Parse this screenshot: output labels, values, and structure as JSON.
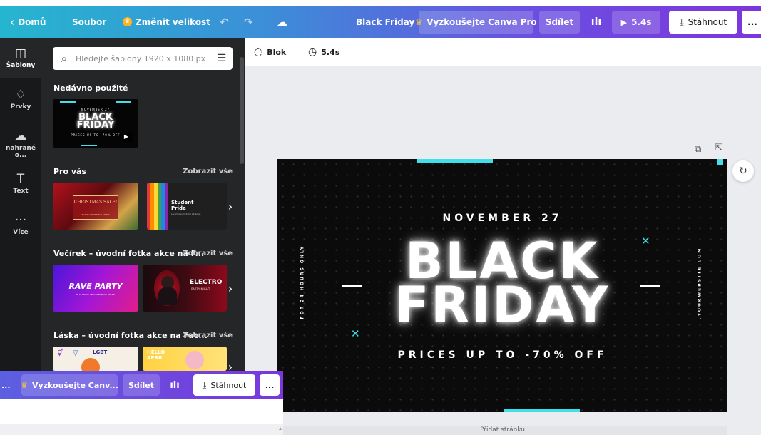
{
  "topbar": {
    "home_label": "Domů",
    "file_label": "Soubor",
    "resize_label": "Změnit velikost",
    "doc_title": "Black Friday",
    "pro_label": "Vyzkoušejte Canva Pro",
    "share_label": "Sdílet",
    "play_label": "5.4s",
    "download_label": "Stáhnout",
    "more_label": "..."
  },
  "rail": {
    "items": [
      {
        "label": "Šablony",
        "icon": "template-icon"
      },
      {
        "label": "Prvky",
        "icon": "elements-icon"
      },
      {
        "label": "nahrané o...",
        "icon": "upload-icon"
      },
      {
        "label": "Text",
        "icon": "text-icon"
      },
      {
        "label": "Více",
        "icon": "more-icon"
      }
    ]
  },
  "panel": {
    "search_placeholder": "Hledejte šablony 1920 x 1080 px",
    "recent_title": "Nedávno použité",
    "recent_thumb": {
      "line1": "NOVEMBER 27",
      "big1": "BLACK",
      "big2": "FRIDAY",
      "line2": "PRICES UP TO -70% OFF"
    },
    "for_you_title": "Pro vás",
    "for_you_see_all": "Zobrazit vše",
    "for_you_thumbs": [
      {
        "title": "CHRISTMAS SALE!",
        "sub": "IN THE CHRISTMAS SPIRIT"
      },
      {
        "title": "Student Pride",
        "sub": "Lorem ipsum dolor sit amet"
      }
    ],
    "party_title": "Večírek – úvodní fotka akce na F...",
    "party_see_all": "Zobrazit vše",
    "party_thumbs": [
      {
        "title": "RAVE PARTY",
        "sub": "PLAY MUSIC AND DANCE ALL NIGHT"
      },
      {
        "title": "ELECTRO",
        "sub": "PARTY NIGHT"
      }
    ],
    "love_title": "Láska – úvodní fotka akce na Fac...",
    "love_see_all": "Zobrazit vše",
    "love_thumbs": [
      {
        "title": "LGBT"
      },
      {
        "title": "HELLO APRIL"
      }
    ]
  },
  "editbar": {
    "blok_label": "Blok",
    "duration_label": "5.4s"
  },
  "canvas": {
    "date": "NOVEMBER 27",
    "headline1": "BLACK",
    "headline2": "FRIDAY",
    "offer": "PRICES UP TO -70% OFF",
    "side_left": "FOR 24 HOURS ONLY",
    "side_right": ".YOURWEBSITE.COM",
    "accent_color": "#3fe0ea"
  },
  "bottom_strip": {
    "label": "Přidat stránku"
  },
  "float_window": {
    "title_fragment": "...",
    "pro_label": "Vyzkoušejte Canv...",
    "share_label": "Sdílet",
    "download_label": "Stáhnout",
    "more_label": "..."
  }
}
